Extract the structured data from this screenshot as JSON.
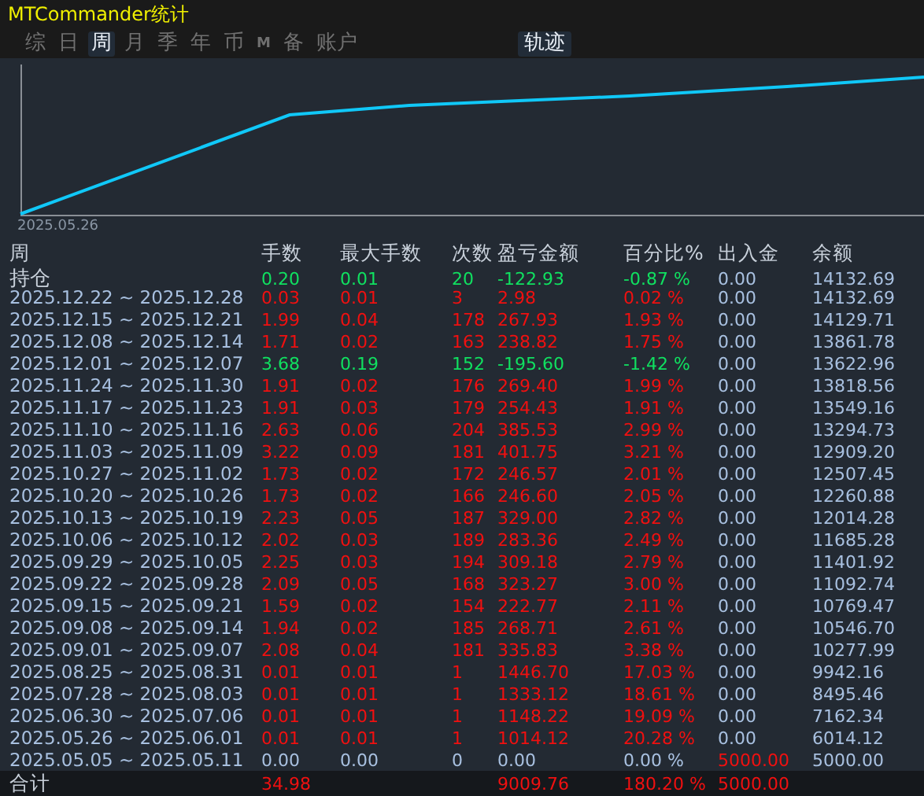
{
  "window": {
    "title": "MTCommander统计"
  },
  "tabs": [
    {
      "label": "综",
      "selected": false,
      "kind": "text"
    },
    {
      "label": "日",
      "selected": false,
      "kind": "text"
    },
    {
      "label": "周",
      "selected": true,
      "kind": "text"
    },
    {
      "label": "月",
      "selected": false,
      "kind": "text"
    },
    {
      "label": "季",
      "selected": false,
      "kind": "text"
    },
    {
      "label": "年",
      "selected": false,
      "kind": "text"
    },
    {
      "label": "币",
      "selected": false,
      "kind": "text"
    },
    {
      "label": "M",
      "selected": false,
      "kind": "small"
    },
    {
      "label": "备",
      "selected": false,
      "kind": "text"
    },
    {
      "label": "账户",
      "selected": false,
      "kind": "text"
    }
  ],
  "view_toggle": {
    "label": "轨迹",
    "selected": true
  },
  "chart": {
    "start_label": "2025.05.26"
  },
  "table": {
    "columns": [
      "周",
      "手数",
      "最大手数",
      "次数",
      "盈亏金额",
      "百分比%",
      "出入金",
      "余额"
    ],
    "rows": [
      {
        "period": "持仓",
        "lots": "0.20",
        "max_lots": "0.01",
        "count": "20",
        "pnl": "-122.93",
        "percent": "-0.87 %",
        "deposit": {
          "value": "0.00",
          "color": "#a8c0e0"
        },
        "balance": "14132.69",
        "color": "#10e060"
      },
      {
        "period": "2025.12.22 ~ 2025.12.28",
        "lots": "0.03",
        "max_lots": "0.01",
        "count": "3",
        "pnl": "2.98",
        "percent": "0.02 %",
        "deposit": {
          "value": "0.00",
          "color": "#a8c0e0"
        },
        "balance": "14132.69",
        "color": "#f01010"
      },
      {
        "period": "2025.12.15 ~ 2025.12.21",
        "lots": "1.99",
        "max_lots": "0.04",
        "count": "178",
        "pnl": "267.93",
        "percent": "1.93 %",
        "deposit": {
          "value": "0.00",
          "color": "#a8c0e0"
        },
        "balance": "14129.71",
        "color": "#f01010"
      },
      {
        "period": "2025.12.08 ~ 2025.12.14",
        "lots": "1.71",
        "max_lots": "0.02",
        "count": "163",
        "pnl": "238.82",
        "percent": "1.75 %",
        "deposit": {
          "value": "0.00",
          "color": "#a8c0e0"
        },
        "balance": "13861.78",
        "color": "#f01010"
      },
      {
        "period": "2025.12.01 ~ 2025.12.07",
        "lots": "3.68",
        "max_lots": "0.19",
        "count": "152",
        "pnl": "-195.60",
        "percent": "-1.42 %",
        "deposit": {
          "value": "0.00",
          "color": "#a8c0e0"
        },
        "balance": "13622.96",
        "color": "#10e060"
      },
      {
        "period": "2025.11.24 ~ 2025.11.30",
        "lots": "1.91",
        "max_lots": "0.02",
        "count": "176",
        "pnl": "269.40",
        "percent": "1.99 %",
        "deposit": {
          "value": "0.00",
          "color": "#a8c0e0"
        },
        "balance": "13818.56",
        "color": "#f01010"
      },
      {
        "period": "2025.11.17 ~ 2025.11.23",
        "lots": "1.91",
        "max_lots": "0.03",
        "count": "179",
        "pnl": "254.43",
        "percent": "1.91 %",
        "deposit": {
          "value": "0.00",
          "color": "#a8c0e0"
        },
        "balance": "13549.16",
        "color": "#f01010"
      },
      {
        "period": "2025.11.10 ~ 2025.11.16",
        "lots": "2.63",
        "max_lots": "0.06",
        "count": "204",
        "pnl": "385.53",
        "percent": "2.99 %",
        "deposit": {
          "value": "0.00",
          "color": "#a8c0e0"
        },
        "balance": "13294.73",
        "color": "#f01010"
      },
      {
        "period": "2025.11.03 ~ 2025.11.09",
        "lots": "3.22",
        "max_lots": "0.09",
        "count": "181",
        "pnl": "401.75",
        "percent": "3.21 %",
        "deposit": {
          "value": "0.00",
          "color": "#a8c0e0"
        },
        "balance": "12909.20",
        "color": "#f01010"
      },
      {
        "period": "2025.10.27 ~ 2025.11.02",
        "lots": "1.73",
        "max_lots": "0.02",
        "count": "172",
        "pnl": "246.57",
        "percent": "2.01 %",
        "deposit": {
          "value": "0.00",
          "color": "#a8c0e0"
        },
        "balance": "12507.45",
        "color": "#f01010"
      },
      {
        "period": "2025.10.20 ~ 2025.10.26",
        "lots": "1.73",
        "max_lots": "0.02",
        "count": "166",
        "pnl": "246.60",
        "percent": "2.05 %",
        "deposit": {
          "value": "0.00",
          "color": "#a8c0e0"
        },
        "balance": "12260.88",
        "color": "#f01010"
      },
      {
        "period": "2025.10.13 ~ 2025.10.19",
        "lots": "2.23",
        "max_lots": "0.05",
        "count": "187",
        "pnl": "329.00",
        "percent": "2.82 %",
        "deposit": {
          "value": "0.00",
          "color": "#a8c0e0"
        },
        "balance": "12014.28",
        "color": "#f01010"
      },
      {
        "period": "2025.10.06 ~ 2025.10.12",
        "lots": "2.02",
        "max_lots": "0.03",
        "count": "189",
        "pnl": "283.36",
        "percent": "2.49 %",
        "deposit": {
          "value": "0.00",
          "color": "#a8c0e0"
        },
        "balance": "11685.28",
        "color": "#f01010"
      },
      {
        "period": "2025.09.29 ~ 2025.10.05",
        "lots": "2.25",
        "max_lots": "0.03",
        "count": "194",
        "pnl": "309.18",
        "percent": "2.79 %",
        "deposit": {
          "value": "0.00",
          "color": "#a8c0e0"
        },
        "balance": "11401.92",
        "color": "#f01010"
      },
      {
        "period": "2025.09.22 ~ 2025.09.28",
        "lots": "2.09",
        "max_lots": "0.05",
        "count": "168",
        "pnl": "323.27",
        "percent": "3.00 %",
        "deposit": {
          "value": "0.00",
          "color": "#a8c0e0"
        },
        "balance": "11092.74",
        "color": "#f01010"
      },
      {
        "period": "2025.09.15 ~ 2025.09.21",
        "lots": "1.59",
        "max_lots": "0.02",
        "count": "154",
        "pnl": "222.77",
        "percent": "2.11 %",
        "deposit": {
          "value": "0.00",
          "color": "#a8c0e0"
        },
        "balance": "10769.47",
        "color": "#f01010"
      },
      {
        "period": "2025.09.08 ~ 2025.09.14",
        "lots": "1.94",
        "max_lots": "0.02",
        "count": "185",
        "pnl": "268.71",
        "percent": "2.61 %",
        "deposit": {
          "value": "0.00",
          "color": "#a8c0e0"
        },
        "balance": "10546.70",
        "color": "#f01010"
      },
      {
        "period": "2025.09.01 ~ 2025.09.07",
        "lots": "2.08",
        "max_lots": "0.04",
        "count": "181",
        "pnl": "335.83",
        "percent": "3.38 %",
        "deposit": {
          "value": "0.00",
          "color": "#a8c0e0"
        },
        "balance": "10277.99",
        "color": "#f01010"
      },
      {
        "period": "2025.08.25 ~ 2025.08.31",
        "lots": "0.01",
        "max_lots": "0.01",
        "count": "1",
        "pnl": "1446.70",
        "percent": "17.03 %",
        "deposit": {
          "value": "0.00",
          "color": "#a8c0e0"
        },
        "balance": "9942.16",
        "color": "#f01010"
      },
      {
        "period": "2025.07.28 ~ 2025.08.03",
        "lots": "0.01",
        "max_lots": "0.01",
        "count": "1",
        "pnl": "1333.12",
        "percent": "18.61 %",
        "deposit": {
          "value": "0.00",
          "color": "#a8c0e0"
        },
        "balance": "8495.46",
        "color": "#f01010"
      },
      {
        "period": "2025.06.30 ~ 2025.07.06",
        "lots": "0.01",
        "max_lots": "0.01",
        "count": "1",
        "pnl": "1148.22",
        "percent": "19.09 %",
        "deposit": {
          "value": "0.00",
          "color": "#a8c0e0"
        },
        "balance": "7162.34",
        "color": "#f01010"
      },
      {
        "period": "2025.05.26 ~ 2025.06.01",
        "lots": "0.01",
        "max_lots": "0.01",
        "count": "1",
        "pnl": "1014.12",
        "percent": "20.28 %",
        "deposit": {
          "value": "0.00",
          "color": "#a8c0e0"
        },
        "balance": "6014.12",
        "color": "#f01010"
      },
      {
        "period": "2025.05.05 ~ 2025.05.11",
        "lots": "0.00",
        "max_lots": "0.00",
        "count": "0",
        "pnl": "0.00",
        "percent": "0.00 %",
        "deposit": {
          "value": "5000.00",
          "color": "#f01010"
        },
        "balance": "5000.00",
        "color": "#a8c0e0"
      }
    ],
    "total": {
      "label": "合计",
      "lots": "34.98",
      "pnl": "9009.76",
      "percent": "180.20 %",
      "deposit": {
        "value": "5000.00",
        "color": "#f01010"
      },
      "color": "#f01010"
    }
  }
}
